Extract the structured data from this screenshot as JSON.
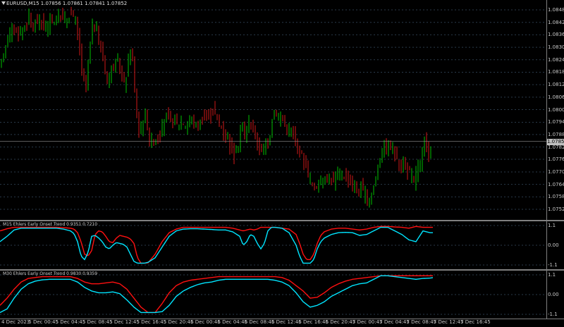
{
  "chart": {
    "title": "EURUSD,M15  1.07856 1.07861 1.07841 1.07852",
    "current_price": "1.07852",
    "colors": {
      "background": "#000000",
      "bull": "#00c000",
      "bear": "#d01818",
      "grid": "#2a3a4a",
      "ind_red": "#ff1010",
      "ind_cyan": "#00e5ff"
    }
  },
  "indicators": {
    "m15_title": "M15 Ehlers Early  Onset Trend 0.9351 0.7210",
    "m30_title": "M30 Ehlers Early  Onset Trend 0.9830 0.9359"
  },
  "chart_data": [
    {
      "type": "candlestick",
      "title": "EURUSD,M15  1.07856 1.07861 1.07841 1.07852",
      "y_ticks": [
        "1.08485",
        "1.08425",
        "1.08365",
        "1.08305",
        "1.08245",
        "1.08185",
        "1.08125",
        "1.08065",
        "1.08005",
        "1.07944",
        "1.07885",
        "1.07825",
        "1.07766",
        "1.07705",
        "1.07645",
        "1.07585",
        "1.07525"
      ],
      "ylim": [
        1.07525,
        1.08485
      ],
      "current_price": 1.07852,
      "path_x": [
        0,
        5,
        10,
        15,
        20,
        25,
        30,
        35,
        40,
        45,
        50,
        55,
        60,
        65,
        70,
        75,
        80,
        85,
        90,
        95,
        100,
        105,
        110,
        115,
        120,
        125,
        130,
        135,
        140,
        145,
        150,
        155,
        160,
        165,
        170,
        175,
        180,
        185,
        190,
        195,
        200,
        205,
        210,
        215,
        220,
        225,
        230,
        235,
        240,
        245,
        250,
        255,
        260,
        265,
        270,
        275,
        280,
        285,
        290,
        295,
        300,
        305,
        310,
        315,
        320,
        325,
        330,
        335,
        340,
        345,
        350,
        355,
        360,
        365,
        370,
        375,
        380,
        385,
        390,
        395,
        400,
        405,
        410,
        415,
        420,
        425,
        430,
        435,
        440,
        445,
        450,
        455,
        460,
        465,
        470,
        475,
        480,
        485,
        490,
        495,
        500,
        505,
        510,
        515,
        520,
        525,
        530,
        535,
        540,
        545,
        550,
        555,
        560,
        565,
        570,
        575,
        580,
        585,
        590,
        595,
        600,
        605,
        610,
        615
      ],
      "path_price": [
        1.0818,
        1.0823,
        1.0831,
        1.0837,
        1.084,
        1.0838,
        1.0836,
        1.0839,
        1.0842,
        1.0845,
        1.084,
        1.0844,
        1.0843,
        1.084,
        1.0841,
        1.0844,
        1.0843,
        1.0845,
        1.0846,
        1.0844,
        1.0846,
        1.0847,
        1.0842,
        1.0833,
        1.0815,
        1.081,
        1.083,
        1.0843,
        1.0838,
        1.0832,
        1.0823,
        1.0815,
        1.0819,
        1.0822,
        1.0824,
        1.0818,
        1.0812,
        1.0825,
        1.083,
        1.0805,
        1.079,
        1.0795,
        1.0799,
        1.0785,
        1.0785,
        1.0787,
        1.0788,
        1.0795,
        1.0798,
        1.0794,
        1.0795,
        1.0793,
        1.0796,
        1.0793,
        1.0795,
        1.0795,
        1.0793,
        1.0794,
        1.0796,
        1.0797,
        1.0797,
        1.08,
        1.0798,
        1.0793,
        1.079,
        1.0788,
        1.0783,
        1.0779,
        1.0782,
        1.0792,
        1.0789,
        1.0794,
        1.0793,
        1.0788,
        1.0783,
        1.0779,
        1.0783,
        1.0786,
        1.08,
        1.0799,
        1.0797,
        1.0795,
        1.0792,
        1.079,
        1.0788,
        1.0782,
        1.0779,
        1.0775,
        1.077,
        1.0765,
        1.0761,
        1.0767,
        1.0766,
        1.0767,
        1.0768,
        1.0766,
        1.077,
        1.0768,
        1.077,
        1.0767,
        1.0765,
        1.0763,
        1.0761,
        1.0762,
        1.076,
        1.0757,
        1.076,
        1.0766,
        1.0775,
        1.0782,
        1.0783,
        1.0782,
        1.0783,
        1.0777,
        1.0774,
        1.0775,
        1.077,
        1.077,
        1.0765,
        1.0775,
        1.0773,
        1.0786,
        1.0778,
        1.0783
      ]
    },
    {
      "type": "line",
      "title": "M15 Ehlers Early  Onset Trend 0.9351 0.7210",
      "y_ticks": [
        "1.1",
        "0.00",
        "-1.1"
      ],
      "ylim": [
        -1.1,
        1.1
      ],
      "path_x": [
        0,
        10,
        20,
        30,
        40,
        50,
        60,
        70,
        80,
        90,
        100,
        105,
        110,
        115,
        120,
        125,
        130,
        135,
        140,
        145,
        150,
        155,
        160,
        165,
        170,
        175,
        180,
        185,
        190,
        195,
        200,
        205,
        210,
        220,
        230,
        240,
        250,
        260,
        270,
        280,
        290,
        300,
        310,
        320,
        330,
        340,
        345,
        350,
        355,
        360,
        365,
        370,
        375,
        380,
        385,
        390,
        400,
        410,
        420,
        425,
        430,
        435,
        440,
        445,
        450,
        455,
        460,
        470,
        480,
        490,
        500,
        510,
        520,
        530,
        540,
        550,
        560,
        570,
        580,
        590,
        600,
        610,
        615
      ],
      "series": [
        {
          "values": [
            0.8,
            0.92,
            1.0,
            1.0,
            1.0,
            1.0,
            1.0,
            1.0,
            1.0,
            0.98,
            0.95,
            0.9,
            0.7,
            0.2,
            -0.5,
            -0.6,
            -0.3,
            0.6,
            0.8,
            0.75,
            0.5,
            0.2,
            0.15,
            0.4,
            0.55,
            0.5,
            0.45,
            0.35,
            0.1,
            -0.7,
            -1.0,
            -1.0,
            -0.98,
            -0.5,
            0.2,
            0.7,
            0.9,
            1.0,
            1.0,
            1.0,
            1.0,
            1.0,
            1.0,
            1.0,
            0.95,
            0.85,
            0.8,
            0.85,
            0.9,
            0.85,
            0.9,
            1.0,
            1.0,
            1.0,
            1.0,
            1.0,
            0.95,
            0.9,
            0.6,
            0.1,
            -0.5,
            -0.8,
            -0.8,
            -0.5,
            0.1,
            0.55,
            0.75,
            0.9,
            0.95,
            0.95,
            0.9,
            0.85,
            0.9,
            1.0,
            1.05,
            1.05,
            1.02,
            1.0,
            0.95,
            1.05,
            1.0,
            1.0,
            1.0
          ]
        },
        {
          "values": [
            0.2,
            0.5,
            0.85,
            0.95,
            0.95,
            0.95,
            0.95,
            0.95,
            0.95,
            0.9,
            0.8,
            0.65,
            0.2,
            -0.6,
            -0.8,
            -0.4,
            0.5,
            0.55,
            0.4,
            0.2,
            -0.1,
            -0.2,
            0.0,
            0.15,
            0.1,
            0.05,
            -0.1,
            -0.5,
            -0.9,
            -1.0,
            -1.0,
            -1.0,
            -0.95,
            -0.7,
            -0.1,
            0.5,
            0.8,
            0.9,
            0.92,
            0.92,
            0.9,
            0.88,
            0.85,
            0.85,
            0.75,
            0.5,
            0.0,
            0.2,
            0.6,
            0.5,
            0.1,
            -0.2,
            0.1,
            0.8,
            1.0,
            1.0,
            0.95,
            0.7,
            0.0,
            -0.6,
            -1.0,
            -1.0,
            -1.0,
            -0.8,
            -0.2,
            0.2,
            0.4,
            0.6,
            0.7,
            0.72,
            0.7,
            0.55,
            0.6,
            0.8,
            1.0,
            1.0,
            0.8,
            0.6,
            0.3,
            0.2,
            0.8,
            0.7,
            0.7
          ]
        }
      ]
    },
    {
      "type": "line",
      "title": "M30 Ehlers Early  Onset Trend 0.9830 0.9359",
      "y_ticks": [
        "1.1",
        "0.00",
        "-1.1"
      ],
      "ylim": [
        -1.1,
        1.1
      ],
      "path_x": [
        0,
        10,
        20,
        30,
        40,
        50,
        60,
        70,
        80,
        90,
        100,
        110,
        120,
        130,
        140,
        150,
        160,
        170,
        180,
        190,
        200,
        210,
        220,
        230,
        240,
        250,
        260,
        270,
        280,
        290,
        300,
        310,
        320,
        330,
        340,
        350,
        360,
        370,
        380,
        390,
        400,
        410,
        420,
        430,
        440,
        450,
        460,
        470,
        480,
        490,
        500,
        510,
        520,
        530,
        540,
        550,
        560,
        570,
        580,
        590,
        600,
        610,
        615
      ],
      "series": [
        {
          "values": [
            -0.6,
            -0.2,
            0.3,
            0.7,
            0.9,
            0.95,
            1.0,
            1.0,
            1.0,
            1.0,
            1.0,
            0.9,
            0.7,
            0.6,
            0.6,
            0.65,
            0.7,
            0.6,
            0.3,
            -0.2,
            -0.7,
            -1.0,
            -1.0,
            -0.5,
            0.1,
            0.5,
            0.7,
            0.8,
            0.85,
            0.9,
            0.95,
            1.0,
            1.0,
            1.0,
            1.0,
            1.0,
            1.0,
            1.0,
            1.0,
            1.0,
            0.95,
            0.8,
            0.5,
            0.2,
            -0.2,
            -0.15,
            0.1,
            0.4,
            0.6,
            0.75,
            0.85,
            0.9,
            0.95,
            1.0,
            1.05,
            1.05,
            1.05,
            1.05,
            1.05,
            1.05,
            1.05,
            1.05,
            1.05
          ]
        },
        {
          "values": [
            -1.0,
            -0.8,
            -0.2,
            0.3,
            0.6,
            0.75,
            0.82,
            0.85,
            0.85,
            0.85,
            0.85,
            0.7,
            0.4,
            0.2,
            0.1,
            0.1,
            0.15,
            0.05,
            -0.3,
            -0.7,
            -1.0,
            -1.0,
            -1.0,
            -0.95,
            -0.6,
            -0.1,
            0.2,
            0.4,
            0.55,
            0.65,
            0.7,
            0.8,
            0.85,
            0.85,
            0.85,
            0.85,
            0.85,
            0.85,
            0.85,
            0.8,
            0.7,
            0.5,
            0.1,
            -0.4,
            -0.7,
            -0.6,
            -0.4,
            -0.1,
            0.1,
            0.3,
            0.5,
            0.6,
            0.65,
            0.85,
            1.05,
            1.05,
            1.0,
            0.95,
            0.9,
            0.85,
            0.9,
            0.92,
            0.95
          ]
        }
      ]
    }
  ],
  "x_axis": {
    "labels": [
      "4 Dec 2023",
      "5 Dec 00:45",
      "5 Dec 04:45",
      "5 Dec 08:45",
      "5 Dec 12:45",
      "5 Dec 16:45",
      "5 Dec 20:45",
      "6 Dec 00:45",
      "6 Dec 04:45",
      "6 Dec 08:45",
      "6 Dec 12:45",
      "6 Dec 16:45",
      "6 Dec 20:45",
      "7 Dec 00:45",
      "7 Dec 04:45",
      "7 Dec 08:45",
      "7 Dec 12:45",
      "7 Dec 16:45"
    ]
  }
}
